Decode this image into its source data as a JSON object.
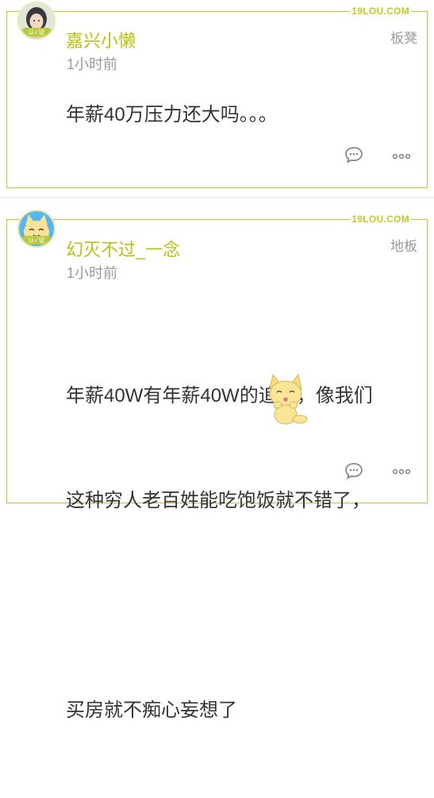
{
  "watermark": "19LOU.COM",
  "posts": [
    {
      "avatar_badge": "认√证",
      "username": "嘉兴小懒",
      "time": "1小时前",
      "floor": "板凳",
      "content": "年薪40万压力还大吗。。。",
      "icons": [
        "reply-icon",
        "more-icon"
      ]
    },
    {
      "avatar_badge": "认√证",
      "username": "幻灭不过_一念",
      "time": "1小时前",
      "floor": "地板",
      "content_lines": [
        "年薪40W有年薪40W的追求，像我们",
        "这种穷人老百姓能吃饱饭就不错了，",
        "",
        "买房就不痴心妄想了"
      ],
      "icons": [
        "reply-icon",
        "more-icon"
      ]
    }
  ],
  "colors": {
    "accent": "#c9c62a",
    "username": "#b7c30e",
    "meta": "#999999",
    "text": "#333333"
  }
}
